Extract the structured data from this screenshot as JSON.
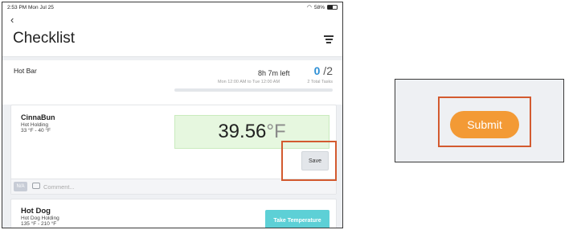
{
  "status_bar": {
    "time_date": "2:53 PM  Mon Jul 25",
    "battery": "58%",
    "battery_level": 0.58
  },
  "header": {
    "back": "‹",
    "title": "Checklist"
  },
  "summary": {
    "location": "Hot Bar",
    "time_left": "8h 7m left",
    "tasks_done": "0",
    "tasks_total": " /2",
    "time_range": "Mon 12:00 AM to Tue 12:00 AM",
    "total_tasks_label": "2 Total Tasks",
    "progress_fraction": 0
  },
  "items": [
    {
      "name": "CinnaBun",
      "type": "Hot Holding",
      "range": "33 °F - 40 °F",
      "temperature": "39.56",
      "unit": "°F",
      "save_label": "Save",
      "na_label": "N/A",
      "comment_placeholder": "Comment..."
    },
    {
      "name": "Hot Dog",
      "type": "Hot Dog Holding",
      "range": "135 °F - 210 °F",
      "action_label": "Take Temperature"
    }
  ],
  "submit_panel": {
    "submit_label": "Submit"
  },
  "colors": {
    "accent_blue": "#2d8fd5",
    "submit_orange": "#f39a35",
    "highlight": "#d35a2f",
    "temp_ok_bg": "#e6f7df",
    "teal": "#5dd0d6"
  },
  "icons": [
    "chevron-left-icon",
    "menu-icon",
    "wifi-icon",
    "battery-icon",
    "comment-icon"
  ]
}
